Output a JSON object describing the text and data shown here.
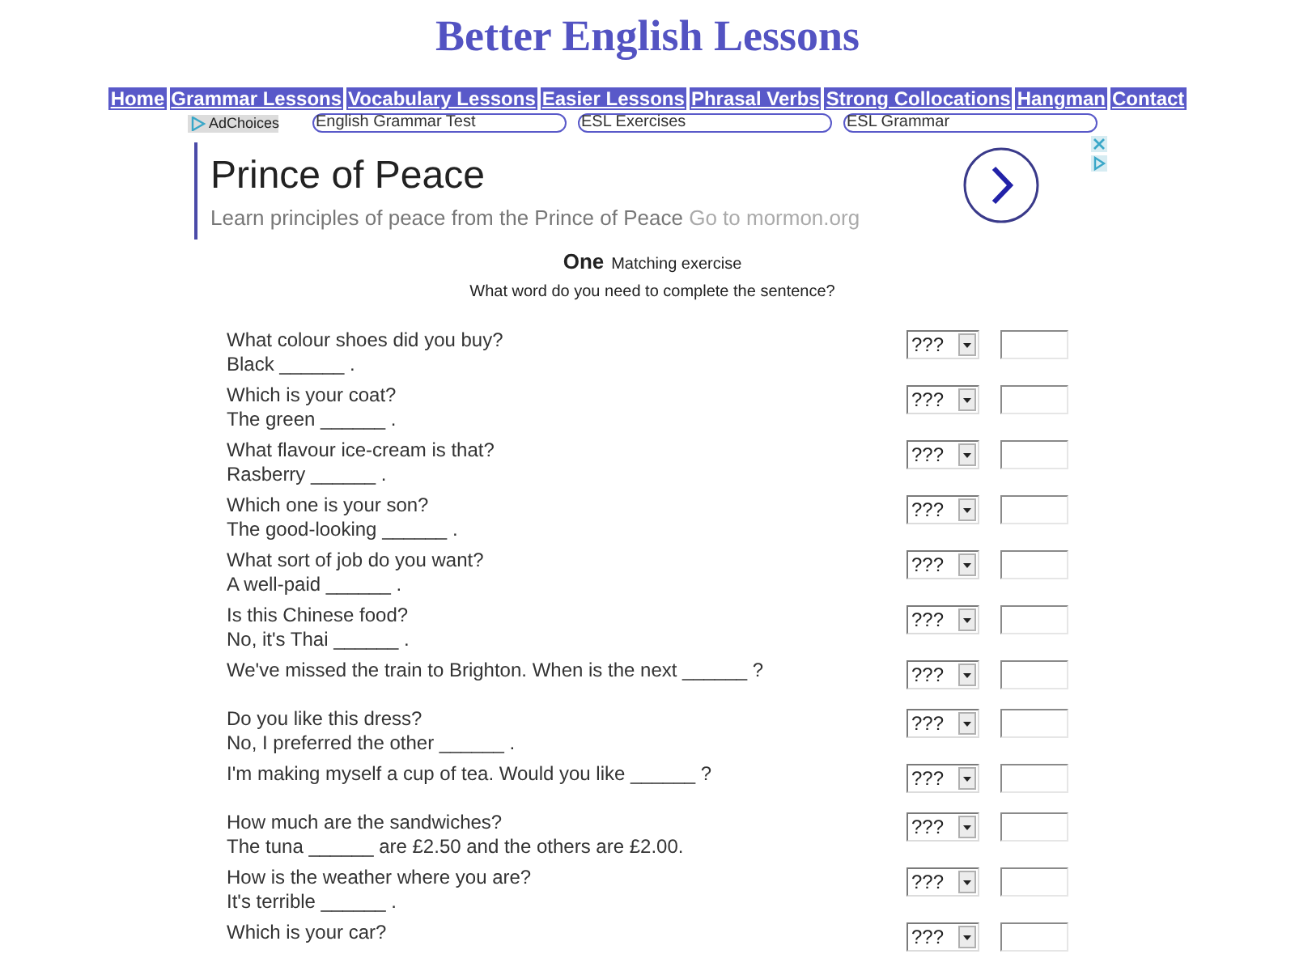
{
  "site_title": "Better English Lessons",
  "nav": [
    "Home",
    "Grammar Lessons",
    "Vocabulary Lessons",
    "Easier Lessons",
    "Phrasal Verbs",
    "Strong Collocations",
    "Hangman",
    "Contact"
  ],
  "ad_links": {
    "adchoices": "AdChoices",
    "links": [
      "English Grammar Test",
      "ESL Exercises",
      "ESL Grammar"
    ]
  },
  "ad": {
    "title": "Prince of Peace",
    "text": "Learn principles of peace from the Prince of Peace",
    "link": "Go to mormon.org"
  },
  "exercise": {
    "number": "One",
    "title": "Matching exercise",
    "instruction": "What word do you need to complete the sentence?",
    "rows": [
      {
        "lines": [
          "What colour shoes did you buy?",
          "Black ______ ."
        ],
        "choice": "???"
      },
      {
        "lines": [
          "Which is your coat?",
          "The green ______ ."
        ],
        "choice": "???"
      },
      {
        "lines": [
          "What flavour ice-cream is that?",
          "Rasberry ______ ."
        ],
        "choice": "???"
      },
      {
        "lines": [
          "Which one is your son?",
          "The good-looking ______ ."
        ],
        "choice": "???"
      },
      {
        "lines": [
          "What sort of job do you want?",
          "A well-paid ______ ."
        ],
        "choice": "???"
      },
      {
        "lines": [
          "Is this Chinese food?",
          "No, it's Thai ______ ."
        ],
        "choice": "???"
      },
      {
        "lines": [
          "We've missed the train to Brighton. When is the next ______ ?"
        ],
        "choice": "???"
      },
      {
        "lines": [
          "Do you like this dress?",
          "No, I preferred the other ______ ."
        ],
        "choice": "???"
      },
      {
        "lines": [
          "I'm making myself a cup of tea. Would you like ______ ?"
        ],
        "choice": "???"
      },
      {
        "lines": [
          "How much are the sandwiches?",
          "The tuna ______ are £2.50 and the others are £2.00."
        ],
        "choice": "???"
      },
      {
        "lines": [
          "How is the weather where you are?",
          "It's terrible ______ ."
        ],
        "choice": "???"
      },
      {
        "lines": [
          "Which is your car?"
        ],
        "choice": "???"
      }
    ]
  }
}
